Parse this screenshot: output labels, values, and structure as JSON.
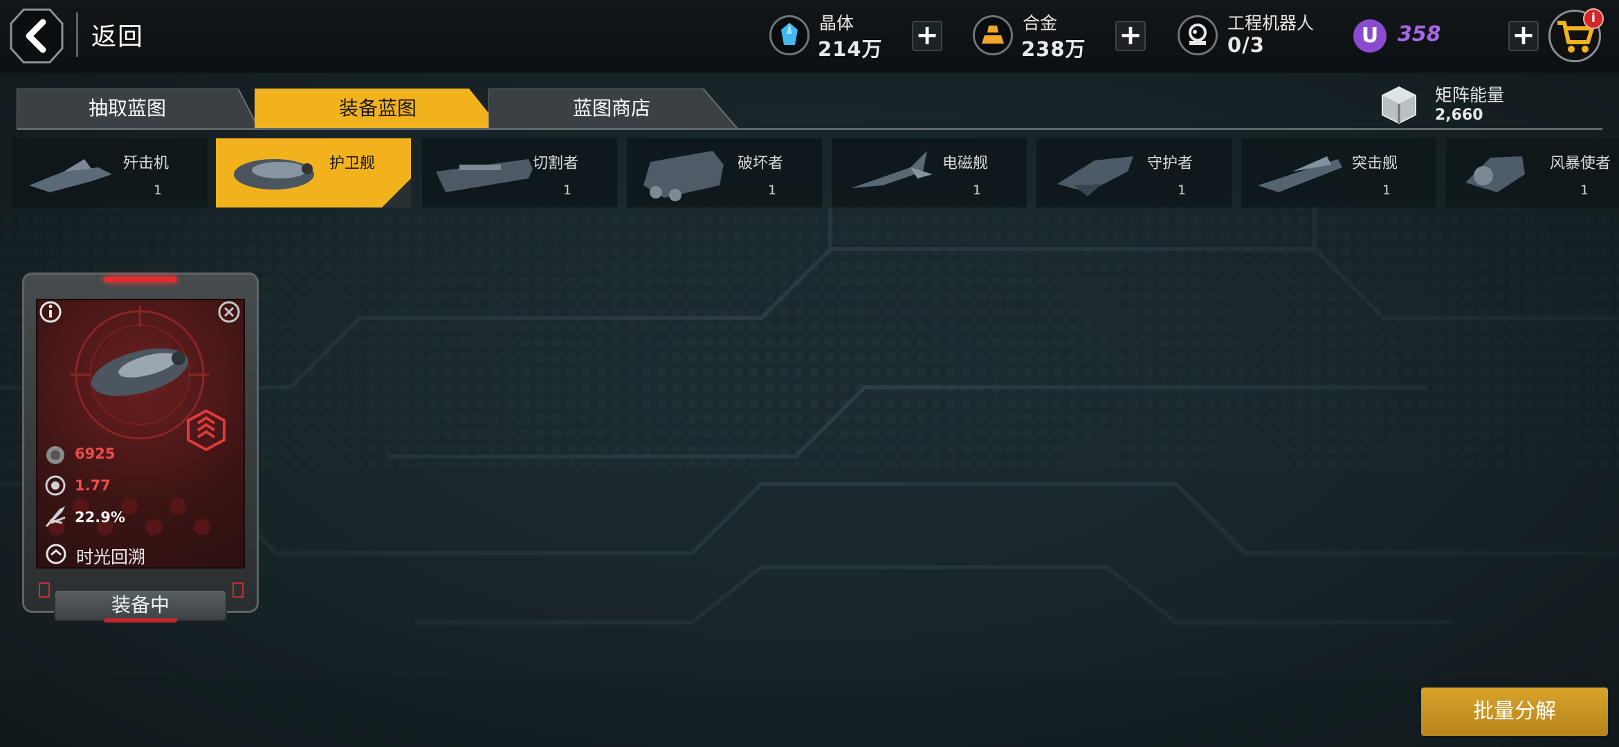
{
  "header": {
    "back_label": "返回",
    "resources": [
      {
        "icon": "crystal-icon",
        "title": "晶体",
        "value": "214万"
      },
      {
        "icon": "alloy-icon",
        "title": "合金",
        "value": "238万"
      },
      {
        "icon": "robot-icon",
        "title": "工程机器人",
        "value": "0/3"
      }
    ],
    "u_currency": {
      "symbol": "U",
      "value": "358"
    },
    "cart_badge": "i"
  },
  "tabs": [
    {
      "label": "抽取蓝图",
      "active": false
    },
    {
      "label": "装备蓝图",
      "active": true
    },
    {
      "label": "蓝图商店",
      "active": false
    }
  ],
  "matrix_energy": {
    "label": "矩阵能量",
    "value": "2,660"
  },
  "ships": [
    {
      "name": "歼击机",
      "count": "1",
      "active": false
    },
    {
      "name": "护卫舰",
      "count": "",
      "active": true
    },
    {
      "name": "切割者",
      "count": "1",
      "active": false
    },
    {
      "name": "破坏者",
      "count": "1",
      "active": false
    },
    {
      "name": "电磁舰",
      "count": "1",
      "active": false
    },
    {
      "name": "守护者",
      "count": "1",
      "active": false
    },
    {
      "name": "突击舰",
      "count": "1",
      "active": false
    },
    {
      "name": "风暴使者",
      "count": "1",
      "active": false
    }
  ],
  "blueprint_card": {
    "stats": [
      {
        "icon": "hp-icon",
        "value": "6925",
        "color": "#f04b4b"
      },
      {
        "icon": "speed-icon",
        "value": "1.77",
        "color": "#f04b4b"
      },
      {
        "icon": "missile-icon",
        "value": "22.9%",
        "color": "#f2f2f2"
      }
    ],
    "skill": "时光回溯",
    "status": "装备中"
  },
  "batch_button": "批量分解",
  "colors": {
    "accent": "#f2b21e",
    "stat_red": "#f04b4b",
    "u_purple": "#a467e6"
  }
}
